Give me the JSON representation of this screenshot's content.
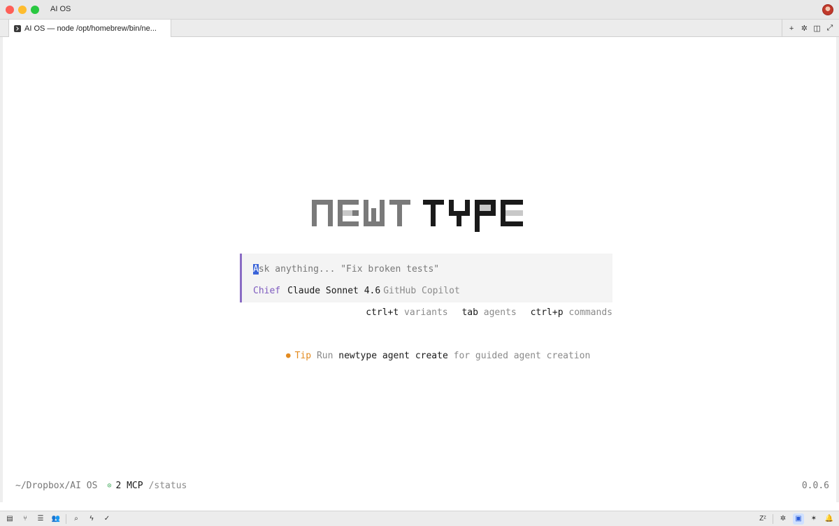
{
  "window": {
    "title": "AI OS"
  },
  "tab": {
    "label": "AI OS — node /opt/homebrew/bin/ne..."
  },
  "tab_actions": [
    {
      "name": "new-tab-icon",
      "glyph": "+"
    },
    {
      "name": "sparkle-icon",
      "glyph": "✲"
    },
    {
      "name": "split-view-icon",
      "glyph": "◫"
    },
    {
      "name": "expand-icon",
      "glyph": "⤢"
    }
  ],
  "logo": {
    "text": "NEWTTYPE",
    "colors": {
      "light": "#7a7a7a",
      "dark": "#1a1a1a",
      "shade": "#c8c8c8"
    }
  },
  "prompt": {
    "cursor_char": "A",
    "placeholder_rest": "sk anything... \"Fix broken tests\"",
    "agent": "Chief",
    "model": "Claude Sonnet 4.6",
    "provider": "GitHub Copilot",
    "accent_color": "#8a6cc4"
  },
  "hints": [
    {
      "key": "ctrl+t",
      "desc": "variants"
    },
    {
      "key": "tab",
      "desc": "agents"
    },
    {
      "key": "ctrl+p",
      "desc": "commands"
    }
  ],
  "tip": {
    "dot": "●",
    "label": "Tip",
    "prefix": "Run",
    "command": "newtype agent create",
    "suffix": "for guided agent creation"
  },
  "status": {
    "path": "~/Dropbox/AI OS",
    "mcp_dot": "⊙",
    "mcp": "2 MCP",
    "command": "/status",
    "version": "0.0.6"
  },
  "bottom_left": [
    {
      "name": "explorer-icon",
      "glyph": "▤"
    },
    {
      "name": "git-branch-icon",
      "glyph": "⑂"
    },
    {
      "name": "list-icon",
      "glyph": "☰"
    },
    {
      "name": "people-icon",
      "glyph": "👥"
    },
    {
      "name": "search-icon",
      "glyph": "⌕"
    },
    {
      "name": "bolt-icon",
      "glyph": "ϟ"
    },
    {
      "name": "check-icon",
      "glyph": "✓"
    }
  ],
  "bottom_right": [
    {
      "name": "sleep-icon",
      "glyph": "Zᶻ"
    },
    {
      "name": "bug-icon",
      "glyph": "✲"
    },
    {
      "name": "terminal-icon",
      "glyph": "▣"
    },
    {
      "name": "sparkle-icon",
      "glyph": "✶"
    },
    {
      "name": "bell-icon",
      "glyph": "🔔"
    }
  ]
}
